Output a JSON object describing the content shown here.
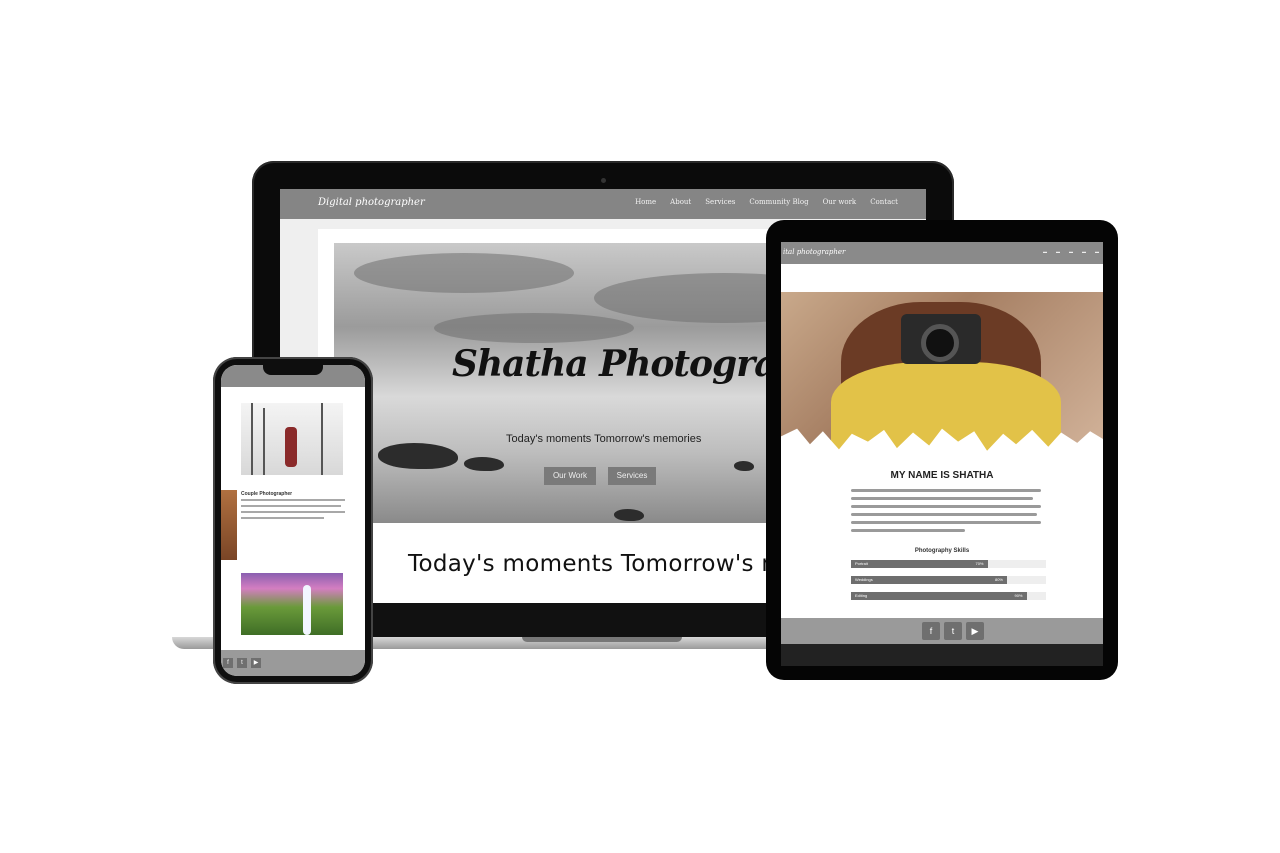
{
  "laptop": {
    "logo": "Digital photographer",
    "menu": [
      "Home",
      "About",
      "Services",
      "Community Blog",
      "Our work",
      "Contact"
    ],
    "hero_title": "Shatha Photography",
    "hero_tagline": "Today's moments Tomorrow's memories",
    "buttons": [
      "Our Work",
      "Services"
    ],
    "heading": "Today's moments Tomorrow's memor"
  },
  "tablet": {
    "logo": "ital photographer",
    "heading": "MY NAME IS SHATHA",
    "skills_title": "Photography Skills",
    "skills": [
      {
        "name": "Portrait",
        "percent": 70
      },
      {
        "name": "Weddings",
        "percent": 80
      },
      {
        "name": "Editing",
        "percent": 90
      }
    ],
    "social_icons": [
      "facebook-icon",
      "twitter-icon",
      "youtube-icon"
    ]
  },
  "phone": {
    "caption_title": "Couple Photographer",
    "social_icons": [
      "facebook-icon",
      "twitter-icon",
      "youtube-icon"
    ]
  }
}
